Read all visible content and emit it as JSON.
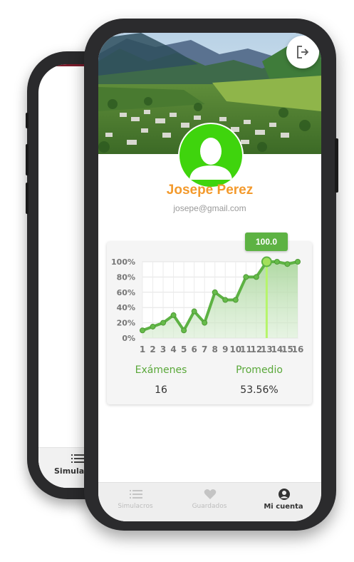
{
  "back_screen": {
    "tab_label": "Simula"
  },
  "profile": {
    "name": "Josepe Perez",
    "email": "josepe@gmail.com"
  },
  "colors": {
    "accent_green": "#5db243",
    "avatar_green": "#3fd40d",
    "name_orange": "#f39a2d",
    "highlight_line": "#b6f56a"
  },
  "chart_data": {
    "type": "area",
    "categories": [
      "1",
      "2",
      "3",
      "4",
      "5",
      "6",
      "7",
      "8",
      "9",
      "10",
      "11",
      "12",
      "13",
      "14",
      "15",
      "16"
    ],
    "series": [
      {
        "values": [
          10,
          15,
          20,
          30,
          10,
          35,
          20,
          60,
          50,
          50,
          80,
          80,
          100,
          100,
          97,
          100
        ]
      }
    ],
    "y_ticks": [
      "0%",
      "20%",
      "40%",
      "60%",
      "80%",
      "100%"
    ],
    "ylim": [
      0,
      100
    ],
    "highlight": {
      "category": "13",
      "value": "100.0"
    },
    "grid": true
  },
  "stats": {
    "exams_label": "Exámenes",
    "exams_value": "16",
    "average_label": "Promedio",
    "average_value": "53.56%"
  },
  "tabs": [
    {
      "label": "Simulacros",
      "icon": "list-icon",
      "active": false
    },
    {
      "label": "Guardados",
      "icon": "heart-icon",
      "active": false
    },
    {
      "label": "Mi cuenta",
      "icon": "account-circle-icon",
      "active": true
    }
  ],
  "header": {
    "logout_icon": "logout-icon"
  }
}
